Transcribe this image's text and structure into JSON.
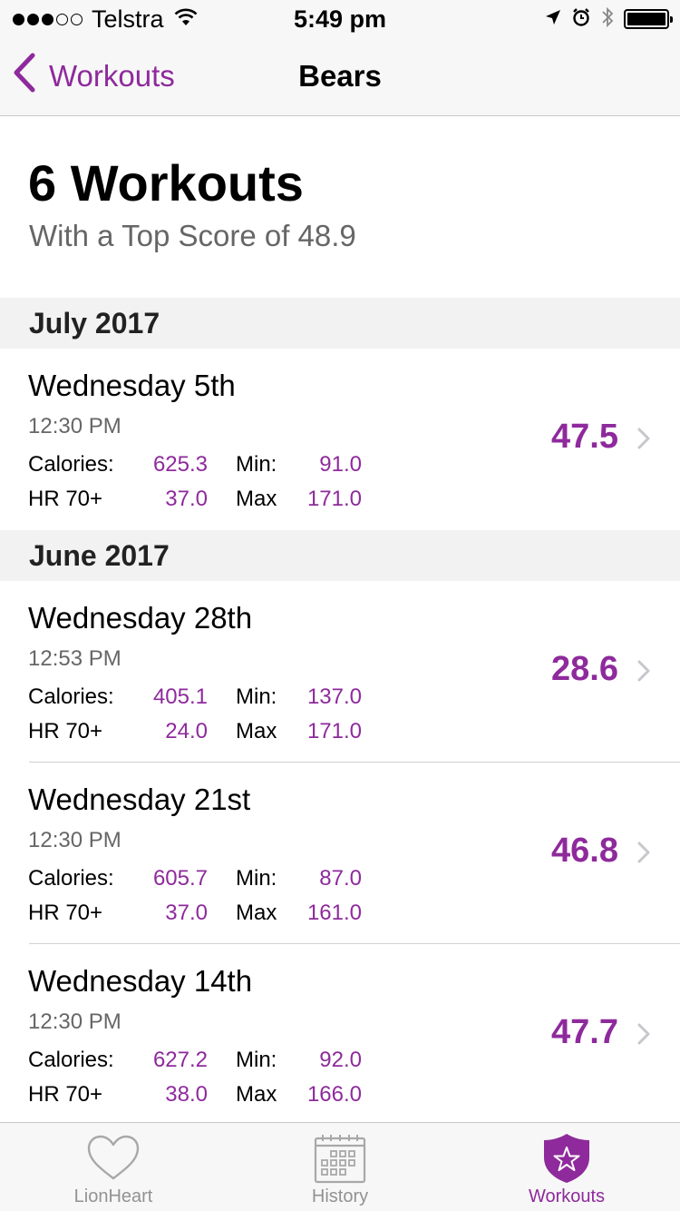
{
  "status_bar": {
    "carrier": "Telstra",
    "time": "5:49 pm",
    "signal_bars_filled": 3,
    "signal_bars_total": 5,
    "icons": [
      "wifi-icon",
      "location-icon",
      "alarm-icon",
      "bluetooth-icon",
      "battery-icon"
    ],
    "battery_level": 1.0
  },
  "nav": {
    "back_label": "Workouts",
    "title": "Bears"
  },
  "summary": {
    "title": "6 Workouts",
    "subtitle": "With a Top Score of 48.9"
  },
  "labels": {
    "calories": "Calories:",
    "min": "Min:",
    "hr": "HR 70+",
    "max": "Max"
  },
  "sections": [
    {
      "title": "July 2017",
      "workouts": [
        {
          "date": "Wednesday 5th",
          "time": "12:30 PM",
          "calories": "625.3",
          "min": "91.0",
          "hr": "37.0",
          "max": "171.0",
          "score": "47.5"
        }
      ]
    },
    {
      "title": "June 2017",
      "workouts": [
        {
          "date": "Wednesday 28th",
          "time": "12:53 PM",
          "calories": "405.1",
          "min": "137.0",
          "hr": "24.0",
          "max": "171.0",
          "score": "28.6"
        },
        {
          "date": "Wednesday 21st",
          "time": "12:30 PM",
          "calories": "605.7",
          "min": "87.0",
          "hr": "37.0",
          "max": "161.0",
          "score": "46.8"
        },
        {
          "date": "Wednesday 14th",
          "time": "12:30 PM",
          "calories": "627.2",
          "min": "92.0",
          "hr": "38.0",
          "max": "166.0",
          "score": "47.7"
        }
      ]
    }
  ],
  "tabs": [
    {
      "label": "LionHeart",
      "icon": "heart-icon",
      "active": false
    },
    {
      "label": "History",
      "icon": "calendar-icon",
      "active": false
    },
    {
      "label": "Workouts",
      "icon": "shield-star-icon",
      "active": true
    }
  ],
  "colors": {
    "accent": "#8e2a9c",
    "inactive_tab": "#929292",
    "section_bg": "#f2f2f2"
  }
}
